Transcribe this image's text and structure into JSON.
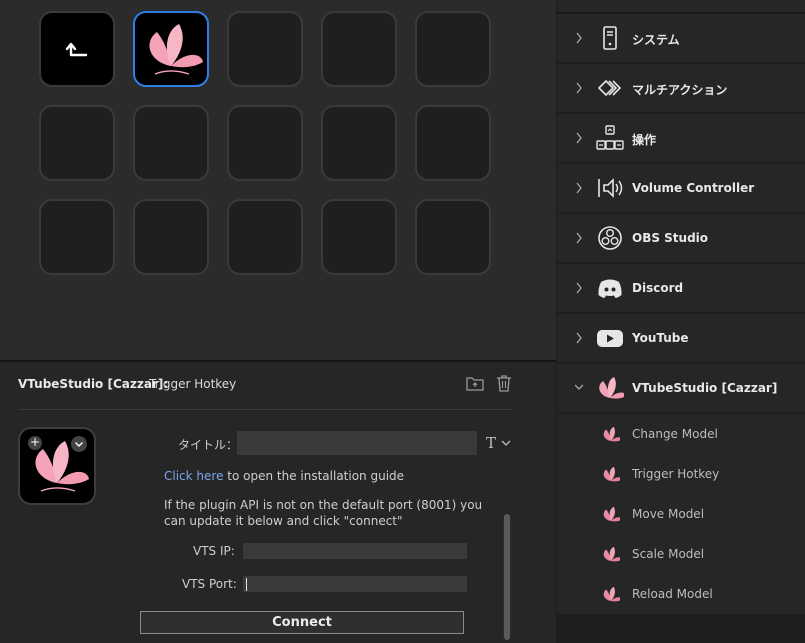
{
  "grid": {
    "rows": 3,
    "cols": 5,
    "keys": [
      {
        "kind": "back"
      },
      {
        "kind": "selected"
      },
      {
        "kind": "empty"
      },
      {
        "kind": "empty"
      },
      {
        "kind": "empty"
      },
      {
        "kind": "empty"
      },
      {
        "kind": "empty"
      },
      {
        "kind": "empty"
      },
      {
        "kind": "empty"
      },
      {
        "kind": "empty"
      },
      {
        "kind": "empty"
      },
      {
        "kind": "empty"
      },
      {
        "kind": "empty"
      },
      {
        "kind": "empty"
      },
      {
        "kind": "empty"
      }
    ]
  },
  "inspector": {
    "plugin_name": "VTubeStudio [Cazzar]:",
    "action_name": "Trigger Hotkey",
    "title_label": "タイトル：",
    "title_value": "",
    "title_type_glyph": "T",
    "guide_link": "Click here",
    "guide_text": " to open the installation guide",
    "port_note": "If the plugin API is not on the default port (8001) you can update it below and click \"connect\"",
    "ip_label": "VTS IP:",
    "ip_value": "",
    "port_label": "VTS Port:",
    "port_value": "",
    "connect_label": "Connect"
  },
  "sidebar": {
    "categories": [
      {
        "label": "システム",
        "icon": "system-icon",
        "expanded": false
      },
      {
        "label": "マルチアクション",
        "icon": "multi-action-icon",
        "expanded": false
      },
      {
        "label": "操作",
        "icon": "navigation-icon",
        "expanded": false
      },
      {
        "label": "Volume Controller",
        "icon": "volume-icon",
        "expanded": false
      },
      {
        "label": "OBS Studio",
        "icon": "obs-icon",
        "expanded": false
      },
      {
        "label": "Discord",
        "icon": "discord-icon",
        "expanded": false
      },
      {
        "label": "YouTube",
        "icon": "youtube-icon",
        "expanded": false
      },
      {
        "label": "VTubeStudio [Cazzar]",
        "icon": "vtube-studio-icon",
        "expanded": true
      }
    ],
    "vtube_actions": [
      {
        "label": "Change Model"
      },
      {
        "label": "Trigger Hotkey"
      },
      {
        "label": "Move Model"
      },
      {
        "label": "Scale Model"
      },
      {
        "label": "Reload Model"
      }
    ]
  },
  "colors": {
    "accent": "#2f7ee6",
    "link": "#7aa6e8",
    "petal": "#f4a3b8"
  }
}
